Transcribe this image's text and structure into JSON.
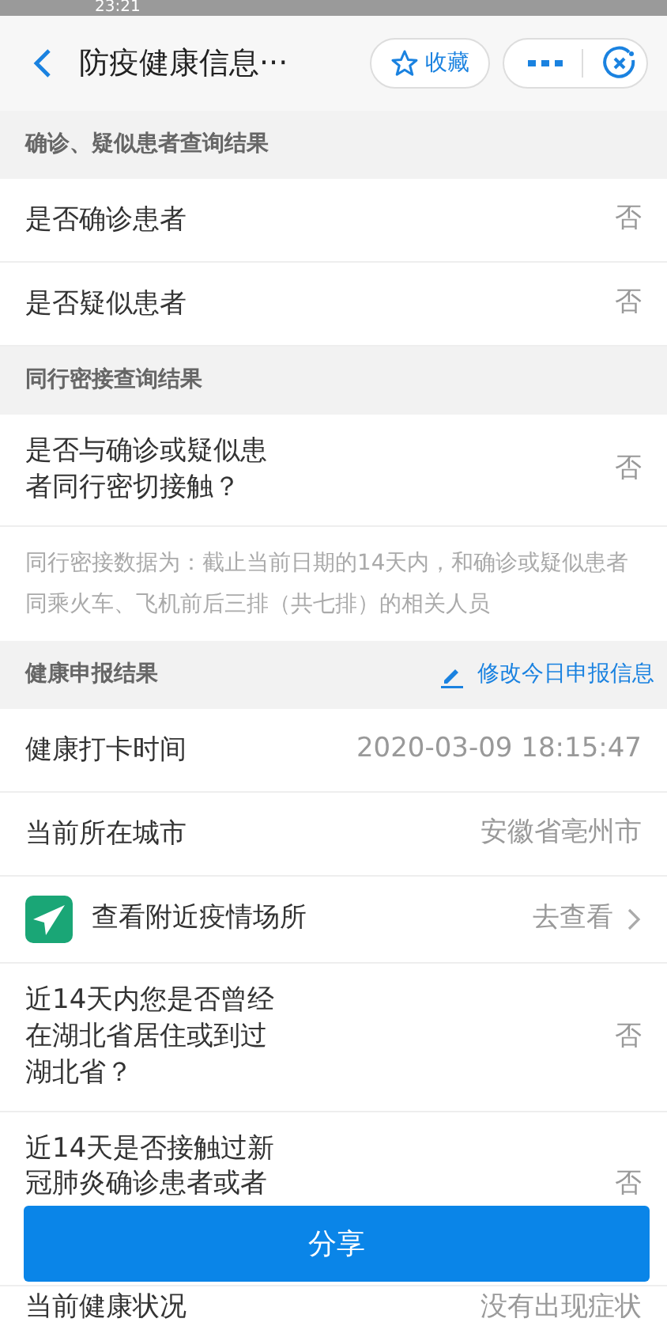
{
  "status_bar": {
    "time": "23:21"
  },
  "header": {
    "title": "防疫健康信息···",
    "favorite_label": "收藏"
  },
  "sections": [
    {
      "title": "确诊、疑似患者查询结果",
      "items": [
        {
          "kind": "row",
          "label": "是否确诊患者",
          "value": "否"
        },
        {
          "kind": "row",
          "label": "是否疑似患者",
          "value": "否"
        }
      ]
    },
    {
      "title": "同行密接查询结果",
      "items": [
        {
          "kind": "row",
          "label": "是否与确诊或疑似患者同行密切接触？",
          "value": "否"
        },
        {
          "kind": "note",
          "text": "同行密接数据为：截止当前日期的14天内，和确诊或疑似患者同乘火车、飞机前后三排（共七排）的相关人员"
        }
      ]
    },
    {
      "title": "健康申报结果",
      "action": "修改今日申报信息",
      "items": [
        {
          "kind": "row",
          "label": "健康打卡时间",
          "value": "2020-03-09 18:15:47"
        },
        {
          "kind": "row",
          "label": "当前所在城市",
          "value": "安徽省亳州市"
        },
        {
          "kind": "link",
          "label": "查看附近疫情场所",
          "value": "去查看"
        },
        {
          "kind": "row",
          "label": "近14天内您是否曾经在湖北省居住或到过湖北省？",
          "value": "否"
        },
        {
          "kind": "covered",
          "label": "近14天是否接触过新冠肺炎确诊患者或者",
          "value": "否"
        },
        {
          "kind": "partial",
          "label": "当前健康状况",
          "value": "没有出现症状"
        }
      ]
    }
  ],
  "share_button": "分享"
}
